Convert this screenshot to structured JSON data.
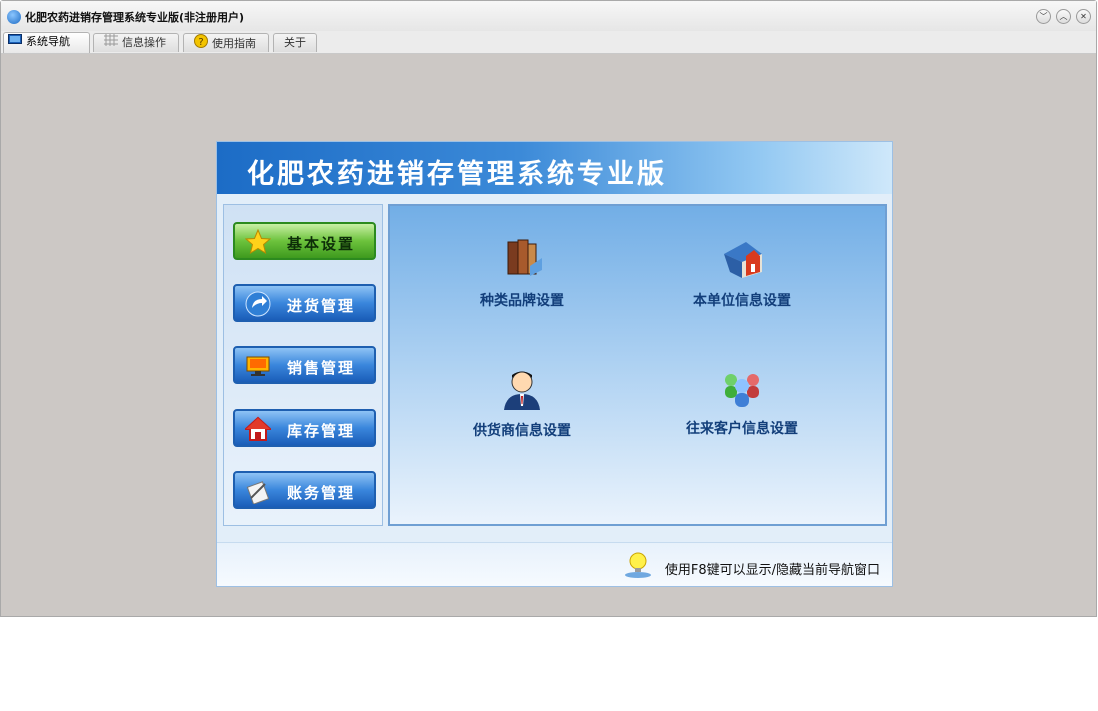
{
  "window": {
    "title": "化肥农药进销存管理系统专业版(非注册用户)",
    "buttons": [
      "minimize",
      "maximize",
      "close"
    ]
  },
  "tabs": [
    {
      "label": "系统导航",
      "icon": "monitor-icon",
      "active": true
    },
    {
      "label": "信息操作",
      "icon": "grid-icon",
      "active": false
    },
    {
      "label": "使用指南",
      "icon": "help-icon",
      "active": false
    },
    {
      "label": "关于",
      "icon": "",
      "active": false
    }
  ],
  "panel": {
    "banner_title": "化肥农药进销存管理系统专业版",
    "nav": [
      {
        "label": "基本设置",
        "icon": "star-icon",
        "selected": true
      },
      {
        "label": "进货管理",
        "icon": "arrow-curve-icon",
        "selected": false
      },
      {
        "label": "销售管理",
        "icon": "monitor-icon",
        "selected": false
      },
      {
        "label": "库存管理",
        "icon": "house-icon",
        "selected": false
      },
      {
        "label": "账务管理",
        "icon": "document-icon",
        "selected": false
      }
    ],
    "items": [
      {
        "label": "种类品牌设置",
        "icon": "books-icon"
      },
      {
        "label": "本单位信息设置",
        "icon": "building-icon"
      },
      {
        "label": "供货商信息设置",
        "icon": "person-icon"
      },
      {
        "label": "往来客户信息设置",
        "icon": "group-icon"
      }
    ],
    "footer_hint": "使用F8键可以显示/隐藏当前导航窗口"
  },
  "colors": {
    "accent": "#1c6cc6",
    "selected_nav": "#6cc23c",
    "window_bg": "#ccc8c5"
  }
}
